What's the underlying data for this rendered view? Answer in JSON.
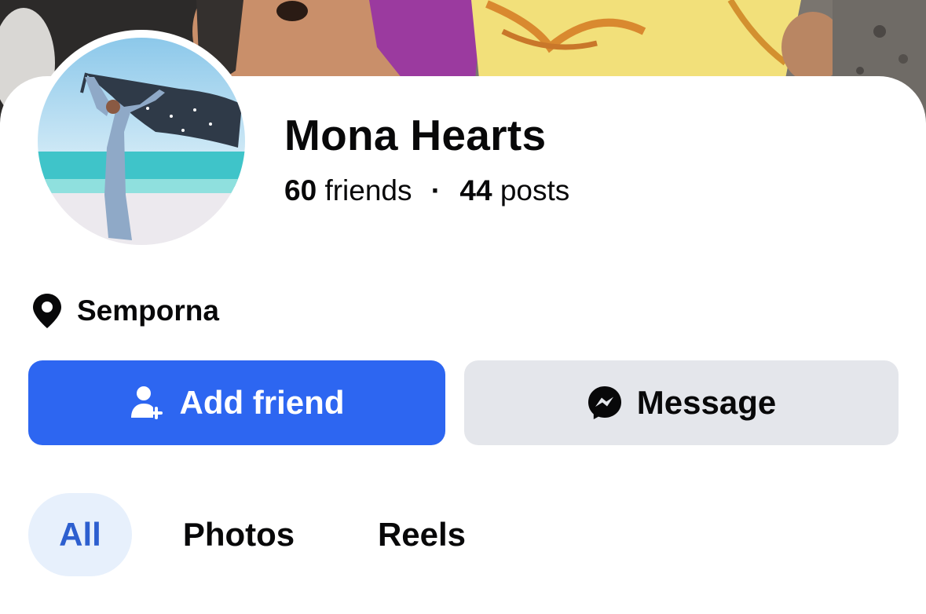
{
  "profile": {
    "name": "Mona Hearts",
    "friends_count": "60",
    "friends_label": "friends",
    "separator": "·",
    "posts_count": "44",
    "posts_label": "posts"
  },
  "location": {
    "icon": "location-pin-icon",
    "text": "Semporna"
  },
  "actions": {
    "add_friend": {
      "label": "Add friend",
      "icon": "add-person-icon"
    },
    "message": {
      "label": "Message",
      "icon": "messenger-icon"
    }
  },
  "tabs": [
    {
      "label": "All",
      "selected": true
    },
    {
      "label": "Photos",
      "selected": false
    },
    {
      "label": "Reels",
      "selected": false
    }
  ],
  "colors": {
    "primary": "#2d66f1",
    "secondary_button": "#e4e6eb",
    "selected_tab_bg": "#e7f0fc",
    "selected_tab_text": "#2d5fcf",
    "text": "#080809"
  }
}
